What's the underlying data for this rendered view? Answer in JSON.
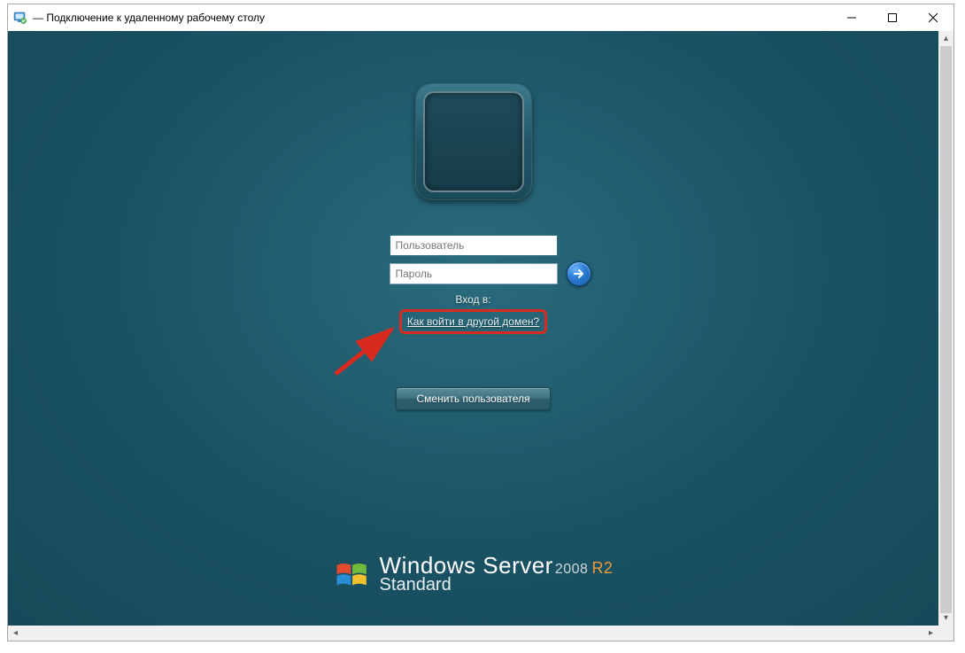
{
  "window": {
    "title_suffix": "— Подключение к удаленному рабочему столу"
  },
  "login": {
    "username_placeholder": "Пользователь",
    "password_placeholder": "Пароль",
    "domain_label": "Вход в:",
    "other_domain_link": "Как войти в другой домен?",
    "switch_user": "Сменить пользователя"
  },
  "branding": {
    "windows": "Windows",
    "server": "Server",
    "year": "2008",
    "r2": "R2",
    "edition": "Standard"
  }
}
